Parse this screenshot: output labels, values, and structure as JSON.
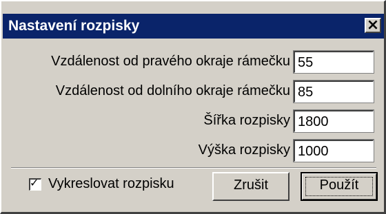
{
  "dialog": {
    "title": "Nastavení rozpisky",
    "close_glyph": "✕"
  },
  "fields": [
    {
      "label": "Vzdálenost od pravého okraje rámečku",
      "value": "55"
    },
    {
      "label": "Vzdálenost od dolního okraje rámečku",
      "value": "85"
    },
    {
      "label": "Šířka rozpisky",
      "value": "1800"
    },
    {
      "label": "Výška rozpisky",
      "value": "1000"
    }
  ],
  "checkbox": {
    "label": "Vykreslovat rozpisku",
    "checked": true,
    "check_glyph": "✓"
  },
  "buttons": {
    "cancel": "Zrušit",
    "apply": "Použít"
  },
  "icons": {
    "close": "close-icon",
    "check": "checkmark-icon"
  }
}
